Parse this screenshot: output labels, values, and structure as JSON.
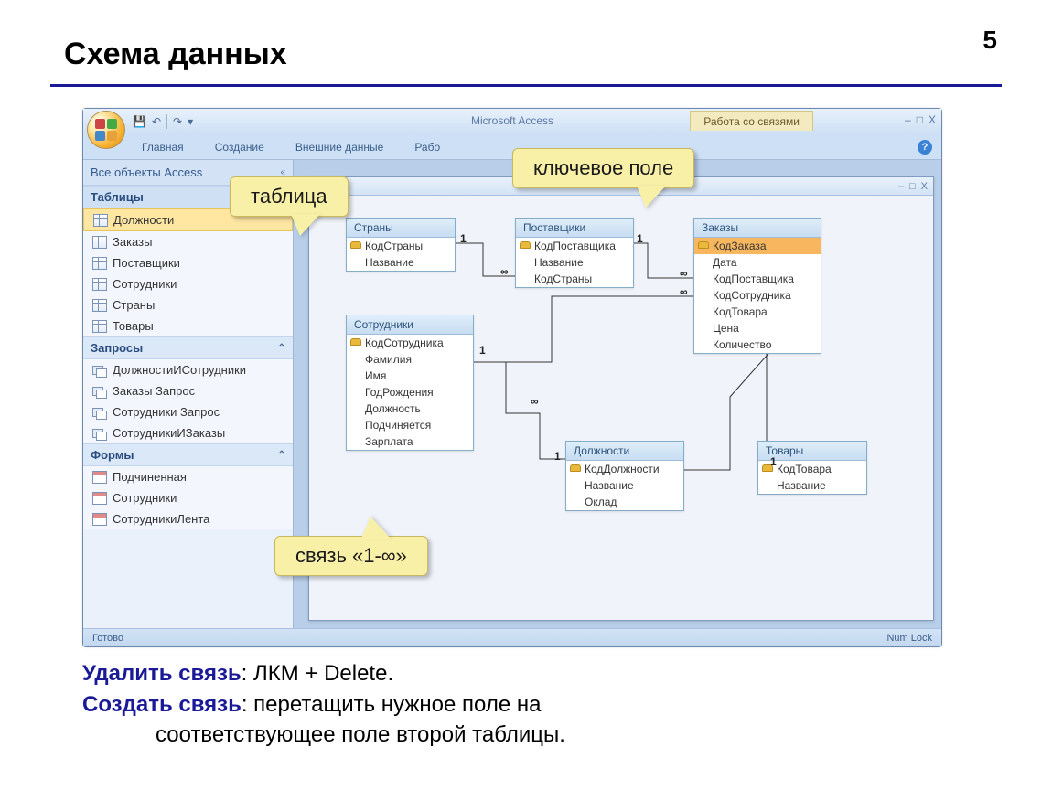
{
  "slide": {
    "number": "5",
    "title": "Схема данных"
  },
  "app": {
    "name": "Microsoft Access",
    "context_tab": "Работа со связями",
    "ribbon_tabs": [
      "Главная",
      "Создание",
      "Внешние данные",
      "Рабо"
    ],
    "help_glyph": "?"
  },
  "win_controls": {
    "min": "–",
    "max": "□",
    "close": "X"
  },
  "qat": {
    "save_glyph": "💾",
    "undo_glyph": "↶",
    "redo_glyph": "↷",
    "dropdown_glyph": "▾"
  },
  "nav": {
    "title": "Все объекты Access",
    "collapse_glyph": "«",
    "sections": [
      {
        "header": "Таблицы",
        "chev": "⌃",
        "type": "table",
        "items": [
          "Должности",
          "Заказы",
          "Поставщики",
          "Сотрудники",
          "Страны",
          "Товары"
        ],
        "selected": 0
      },
      {
        "header": "Запросы",
        "chev": "⌃",
        "type": "query",
        "items": [
          "ДолжностиИСотрудники",
          "Заказы Запрос",
          "Сотрудники Запрос",
          "СотрудникиИЗаказы"
        ]
      },
      {
        "header": "Формы",
        "chev": "⌃",
        "type": "form",
        "items": [
          "Подчиненная",
          "Сотрудники",
          "СотрудникиЛента"
        ]
      }
    ]
  },
  "child": {
    "title_suffix": "данных",
    "controls": {
      "min": "–",
      "max": "□",
      "close": "X"
    }
  },
  "tables": {
    "strany": {
      "title": "Страны",
      "fields": [
        {
          "n": "КодСтраны",
          "key": true
        },
        {
          "n": "Название"
        }
      ]
    },
    "post": {
      "title": "Поставщики",
      "fields": [
        {
          "n": "КодПоставщика",
          "key": true
        },
        {
          "n": "Название"
        },
        {
          "n": "КодСтраны"
        }
      ]
    },
    "zakazy": {
      "title": "Заказы",
      "fields": [
        {
          "n": "КодЗаказа",
          "key": true,
          "sel": true
        },
        {
          "n": "Дата"
        },
        {
          "n": "КодПоставщика"
        },
        {
          "n": "КодСотрудника"
        },
        {
          "n": "КодТовара"
        },
        {
          "n": "Цена"
        },
        {
          "n": "Количество"
        }
      ]
    },
    "sotr": {
      "title": "Сотрудники",
      "fields": [
        {
          "n": "КодСотрудника",
          "key": true
        },
        {
          "n": "Фамилия"
        },
        {
          "n": "Имя"
        },
        {
          "n": "ГодРождения"
        },
        {
          "n": "Должность"
        },
        {
          "n": "Подчиняется"
        },
        {
          "n": "Зарплата"
        }
      ]
    },
    "dolzh": {
      "title": "Должности",
      "fields": [
        {
          "n": "КодДолжности",
          "key": true
        },
        {
          "n": "Название"
        },
        {
          "n": "Оклад"
        }
      ]
    },
    "tovary": {
      "title": "Товары",
      "fields": [
        {
          "n": "КодТовара",
          "key": true
        },
        {
          "n": "Название"
        }
      ]
    }
  },
  "rel_labels": {
    "one": "1",
    "many": "∞"
  },
  "callouts": {
    "table": "таблица",
    "keyfield": "ключевое поле",
    "relation": "связь «1-∞»"
  },
  "status": {
    "left": "Готово",
    "right": "Num Lock"
  },
  "footer": {
    "line1_b": "Удалить связь",
    "line1_rest": ": ЛКМ + Delete.",
    "line2_b": "Создать связь",
    "line2_rest": ": перетащить нужное поле на",
    "line2_cont": "соответствующее поле второй таблицы."
  }
}
